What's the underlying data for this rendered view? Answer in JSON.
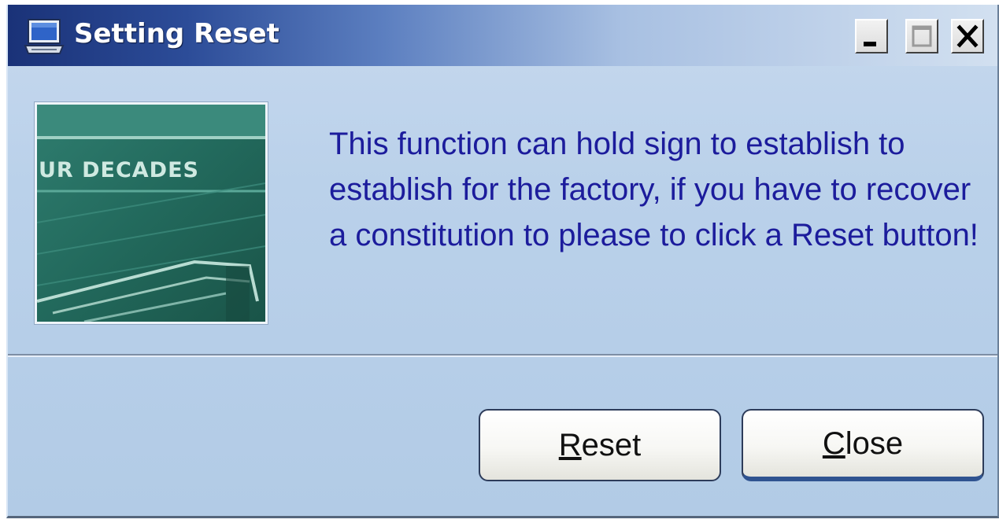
{
  "window": {
    "title": "Setting Reset",
    "icon": "computer-icon",
    "controls": [
      "minimize-icon",
      "maximize-icon",
      "close-icon"
    ]
  },
  "image": {
    "text": "UR DECADES"
  },
  "message": "This function can hold sign to establish to establish for the factory, if you have to recover a constitution to please to click a Reset button!",
  "buttons": {
    "reset": {
      "mnemonic": "R",
      "rest": "eset"
    },
    "close": {
      "mnemonic": "C",
      "rest": "lose"
    }
  },
  "colors": {
    "title_bar_dark": "#1a3278",
    "window_background": "#bad1ea",
    "message_text": "#1c1c9c"
  }
}
